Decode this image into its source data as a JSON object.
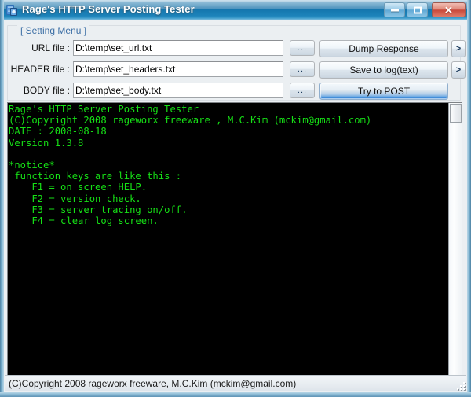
{
  "window": {
    "title": "Rage's HTTP Server Posting Tester",
    "icon": "app-icon",
    "caption_buttons": {
      "minimize": "minimize-icon",
      "maximize": "maximize-icon",
      "close": "✕"
    }
  },
  "group": {
    "legend": "[ Setting Menu ]"
  },
  "fields": [
    {
      "label": "URL file :",
      "value": "D:\\temp\\set_url.txt",
      "placeholder": "",
      "browse_label": "...",
      "name": "url-file"
    },
    {
      "label": "HEADER file :",
      "value": "D:\\temp\\set_headers.txt",
      "placeholder": "",
      "browse_label": "...",
      "name": "header-file"
    },
    {
      "label": "BODY file :",
      "value": "D:\\temp\\set_body.txt",
      "placeholder": "",
      "browse_label": "...",
      "name": "body-file"
    }
  ],
  "actions": {
    "dump_response": "Dump Response",
    "save_to_log": "Save to log(text)",
    "try_to_post": "Try to POST",
    "arrow_label": ">"
  },
  "console": {
    "lines": [
      "Rage's HTTP Server Posting Tester",
      "(C)Copyright 2008 rageworx freeware , M.C.Kim (mckim@gmail.com)",
      "DATE : 2008-08-18",
      "Version 1.3.8",
      "",
      "*notice*",
      " function keys are like this :",
      "    F1 = on screen HELP.",
      "    F2 = version check.",
      "    F3 = server tracing on/off.",
      "    F4 = clear log screen."
    ],
    "text_color": "#16e016",
    "background_color": "#000000"
  },
  "statusbar": {
    "text": "(C)Copyright 2008 rageworx freeware, M.C.Kim (mckim@gmail.com)"
  },
  "colors": {
    "accent": "#2f7fd4",
    "title_blue": "#1476ad",
    "group_label": "#3b6ea5",
    "client_bg": "#ebeff2"
  }
}
